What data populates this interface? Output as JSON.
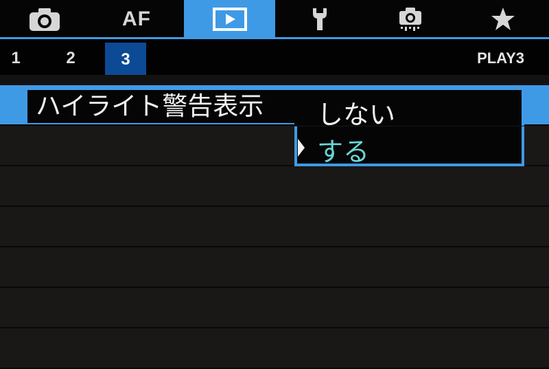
{
  "tabs": [
    {
      "icon": "camera-icon",
      "label": ""
    },
    {
      "icon": "",
      "label": "AF"
    },
    {
      "icon": "playback-icon",
      "label": "",
      "active": true
    },
    {
      "icon": "wrench-icon",
      "label": ""
    },
    {
      "icon": "custom-function-icon",
      "label": ""
    },
    {
      "icon": "star-icon",
      "label": ""
    }
  ],
  "pages": [
    "1",
    "2",
    "3"
  ],
  "active_page": "3",
  "page_title": "PLAY3",
  "menu": {
    "item_label": "ハイライト警告表示",
    "options": [
      "しない",
      "する"
    ],
    "selected_option": "する"
  },
  "colors": {
    "accent": "#3f9ae6",
    "active_page_bg": "#0c4a96",
    "selected_option_text": "#6cd6d6"
  }
}
